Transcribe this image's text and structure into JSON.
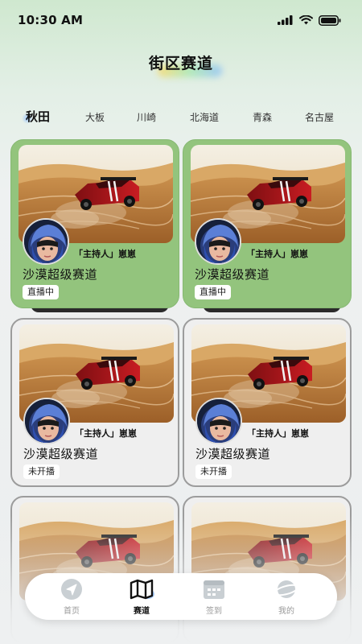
{
  "status_bar": {
    "time": "10:30 AM"
  },
  "page": {
    "title": "街区赛道"
  },
  "tabs": [
    {
      "label": "秋田",
      "active": true
    },
    {
      "label": "大板",
      "active": false
    },
    {
      "label": "川崎",
      "active": false
    },
    {
      "label": "北海道",
      "active": false
    },
    {
      "label": "青森",
      "active": false
    },
    {
      "label": "名古屋",
      "active": false
    }
  ],
  "cards": [
    {
      "host": "「主持人」崽崽",
      "title": "沙漠超级赛道",
      "status": "直播中"
    },
    {
      "host": "「主持人」崽崽",
      "title": "沙漠超级赛道",
      "status": "直播中"
    },
    {
      "host": "「主持人」崽崽",
      "title": "沙漠超级赛道",
      "status": "未开播"
    },
    {
      "host": "「主持人」崽崽",
      "title": "沙漠超级赛道",
      "status": "未开播"
    }
  ],
  "nav": [
    {
      "label": "首页",
      "icon": "send-icon",
      "active": false
    },
    {
      "label": "赛道",
      "icon": "map-icon",
      "active": true
    },
    {
      "label": "签到",
      "icon": "calendar-icon",
      "active": false
    },
    {
      "label": "我的",
      "icon": "planet-icon",
      "active": false
    }
  ],
  "colors": {
    "live_card": "#93c47d",
    "off_card": "#efefef",
    "accent_glow": "#8cbeff"
  }
}
